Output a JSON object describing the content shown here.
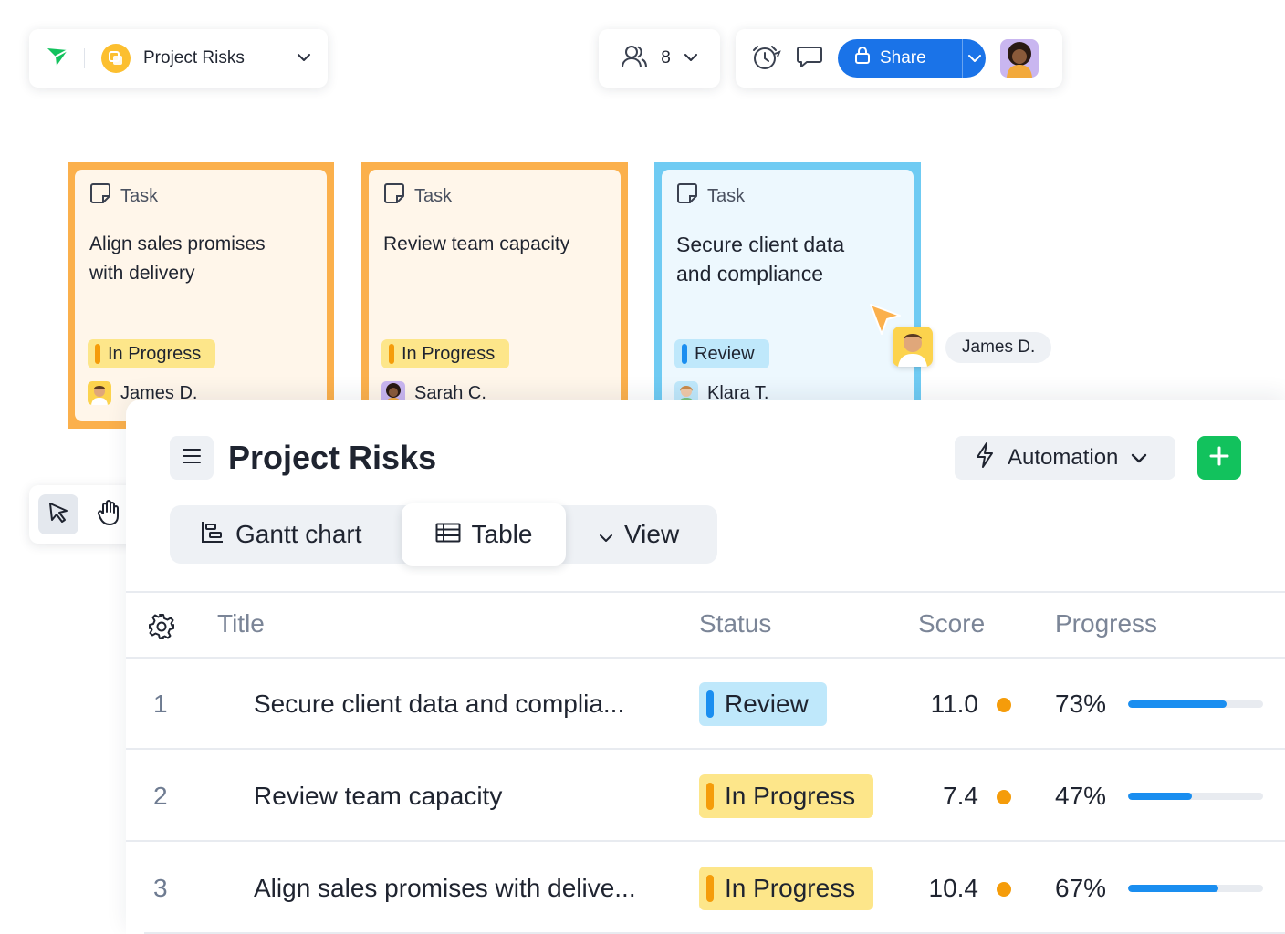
{
  "topbar": {
    "project_name": "Project Risks",
    "user_count": "8",
    "share_label": "Share"
  },
  "cards": [
    {
      "type": "Task",
      "title_line1": "Align sales promises",
      "title_line2": "with delivery",
      "status": "In Progress",
      "assignee": "James D."
    },
    {
      "type": "Task",
      "title_line1": "Review team capacity",
      "title_line2": "",
      "status": "In Progress",
      "assignee": "Sarah C."
    },
    {
      "type": "Task",
      "title_line1": "Secure client data",
      "title_line2": "and compliance",
      "status": "Review",
      "assignee": "Klara T."
    }
  ],
  "cursor_label": "James D.",
  "panel": {
    "title": "Project Risks",
    "automation_label": "Automation",
    "tabs": [
      "Gantt chart",
      "Table",
      "View"
    ],
    "active_tab": "Table"
  },
  "table": {
    "headers": [
      "Title",
      "Status",
      "Score",
      "Progress"
    ],
    "rows": [
      {
        "num": "1",
        "title": "Secure client data and complia...",
        "status": "Review",
        "score": "11.0",
        "progress_label": "73%",
        "progress": 0.73
      },
      {
        "num": "2",
        "title": "Review team capacity",
        "status": "In Progress",
        "score": "7.4",
        "progress_label": "47%",
        "progress": 0.47
      },
      {
        "num": "3",
        "title": "Align sales promises with delive...",
        "status": "In Progress",
        "score": "10.4",
        "progress_label": "67%",
        "progress": 0.67
      }
    ]
  },
  "colors": {
    "accent_blue": "#1a73e8",
    "add_green": "#12c25d",
    "in_progress_bg": "#fde68a",
    "in_progress_bar": "#f59c0a",
    "review_bg": "#bfe8fb",
    "review_bar": "#1a8ef0",
    "card_orange_border": "#fbb04c",
    "card_blue_border": "#6fcbf3",
    "score_dot": "#f59c0a"
  }
}
